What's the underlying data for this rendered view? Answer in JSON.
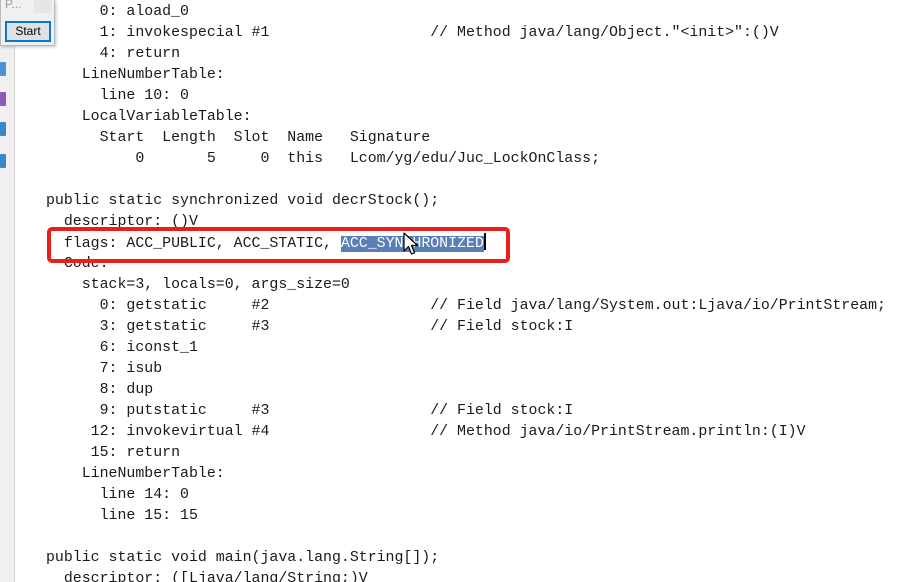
{
  "mini_window": {
    "title": "P...",
    "start_label": "Start"
  },
  "code_lines": [
    "      0: aload_0",
    "      1: invokespecial #1                  // Method java/lang/Object.\"<init>\":()V",
    "      4: return",
    "    LineNumberTable:",
    "      line 10: 0",
    "    LocalVariableTable:",
    "      Start  Length  Slot  Name   Signature",
    "          0       5     0  this   Lcom/yg/edu/Juc_LockOnClass;",
    "",
    "public static synchronized void decrStock();",
    "  descriptor: ()V",
    "  flags: ACC_PUBLIC, ACC_STATIC, ",
    "  Code:",
    "    stack=3, locals=0, args_size=0",
    "      0: getstatic     #2                  // Field java/lang/System.out:Ljava/io/PrintStream;",
    "      3: getstatic     #3                  // Field stock:I",
    "      6: iconst_1",
    "      7: isub",
    "      8: dup",
    "      9: putstatic     #3                  // Field stock:I",
    "     12: invokevirtual #4                  // Method java/io/PrintStream.println:(I)V",
    "     15: return",
    "    LineNumberTable:",
    "      line 14: 0",
    "      line 15: 15",
    "",
    "public static void main(java.lang.String[]);",
    "  descriptor: ([Ljava/lang/String;)V"
  ],
  "selected_text": "ACC_SYNCHRONIZED",
  "colors": {
    "annotation": "#e8201c",
    "selection": "#5a7fb6"
  }
}
